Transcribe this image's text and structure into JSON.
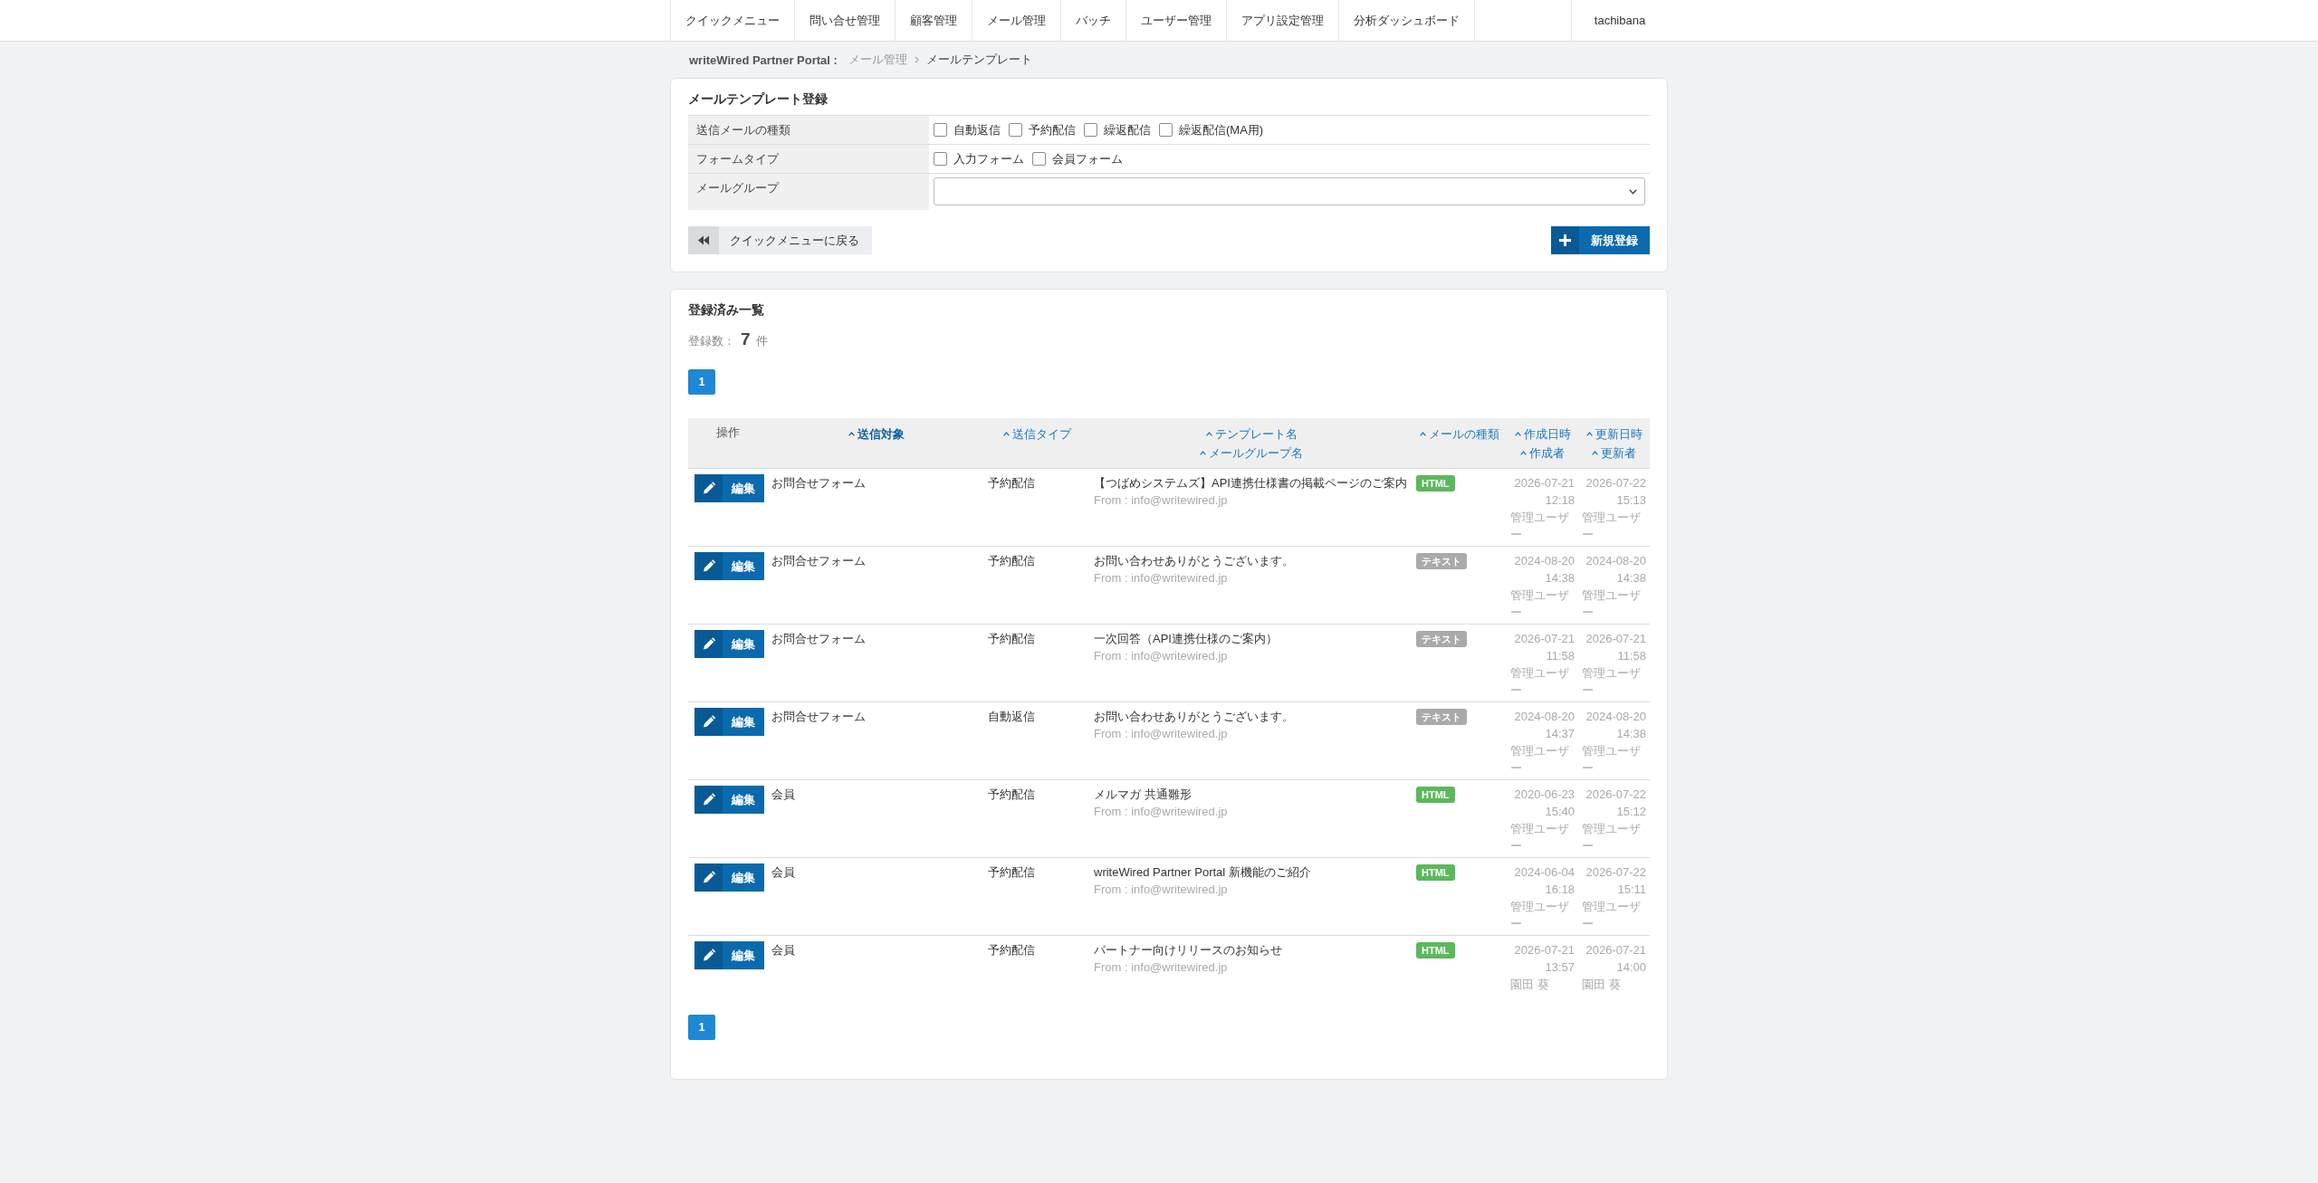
{
  "nav": {
    "items": [
      "クイックメニュー",
      "問い合せ管理",
      "顧客管理",
      "メール管理",
      "バッチ",
      "ユーザー管理",
      "アプリ設定管理",
      "分析ダッシュボード"
    ],
    "user": "tachibana"
  },
  "breadcrumb": {
    "site": "writeWired Partner Portal :",
    "items": [
      {
        "label": "メール管理",
        "current": false
      },
      {
        "label": "メールテンプレート",
        "current": true
      }
    ]
  },
  "register_form": {
    "title": "メールテンプレート登録",
    "fields": [
      {
        "label": "送信メールの種類",
        "kind": "checkboxes",
        "options": [
          {
            "label": "自動返信",
            "checked": false
          },
          {
            "label": "予約配信",
            "checked": false
          },
          {
            "label": "繰返配信",
            "checked": false
          },
          {
            "label": "繰返配信(MA用)",
            "checked": false
          }
        ]
      },
      {
        "label": "フォームタイプ",
        "kind": "checkboxes",
        "options": [
          {
            "label": "入力フォーム",
            "checked": false
          },
          {
            "label": "会員フォーム",
            "checked": false
          }
        ]
      },
      {
        "label": "メールグループ",
        "kind": "select"
      }
    ],
    "back_button": "クイックメニューに戻る",
    "submit_button": "新規登録"
  },
  "registered_list": {
    "title": "登録済み一覧",
    "count_label": "登録数：",
    "count": "7",
    "count_unit": "件",
    "pages": [
      {
        "label": "1",
        "selected": true
      }
    ],
    "columns": [
      {
        "label": "操作"
      },
      {
        "links": [
          {
            "label": "送信対象",
            "sorted": true
          }
        ]
      },
      {
        "links": [
          {
            "label": "送信タイプ",
            "sorted": false
          }
        ]
      },
      {
        "links": [
          {
            "label": "テンプレート名",
            "sorted": false
          },
          {
            "label": "メールグループ名",
            "sorted": false
          }
        ]
      },
      {
        "links": [
          {
            "label": "メールの種類",
            "sorted": false
          }
        ]
      },
      {
        "links": [
          {
            "label": "作成日時",
            "sorted": false
          },
          {
            "label": "作成者",
            "sorted": false
          }
        ]
      },
      {
        "links": [
          {
            "label": "更新日時",
            "sorted": false
          },
          {
            "label": "更新者",
            "sorted": false
          }
        ]
      }
    ],
    "rows": [
      {
        "edit": "編集",
        "target": "お問合せフォーム",
        "send_type": "予約配信",
        "template": "【つばめシステムズ】API連携仕様書の掲載ページのご案内",
        "sender": "From : info@writewired.jp",
        "mail_type": {
          "label": "HTML",
          "color": "#5cb85c"
        },
        "created": "2026-07-21 12:18",
        "created_by": "管理ユーザー",
        "updated": "2026-07-22 15:13",
        "updated_by": "管理ユーザー"
      },
      {
        "edit": "編集",
        "target": "お問合せフォーム",
        "send_type": "予約配信",
        "template": "お問い合わせありがとうございます。",
        "sender": "From : info@writewired.jp",
        "mail_type": {
          "label": "テキスト",
          "color": "#aaaaaa"
        },
        "created": "2024-08-20 14:38",
        "created_by": "管理ユーザー",
        "updated": "2024-08-20 14:38",
        "updated_by": "管理ユーザー"
      },
      {
        "edit": "編集",
        "target": "お問合せフォーム",
        "send_type": "予約配信",
        "template": "一次回答（API連携仕様のご案内）",
        "sender": "From : info@writewired.jp",
        "mail_type": {
          "label": "テキスト",
          "color": "#aaaaaa"
        },
        "created": "2026-07-21 11:58",
        "created_by": "管理ユーザー",
        "updated": "2026-07-21 11:58",
        "updated_by": "管理ユーザー"
      },
      {
        "edit": "編集",
        "target": "お問合せフォーム",
        "send_type": "自動返信",
        "template": "お問い合わせありがとうございます。",
        "sender": "From : info@writewired.jp",
        "mail_type": {
          "label": "テキスト",
          "color": "#aaaaaa"
        },
        "created": "2024-08-20 14:37",
        "created_by": "管理ユーザー",
        "updated": "2024-08-20 14:38",
        "updated_by": "管理ユーザー"
      },
      {
        "edit": "編集",
        "target": "会員",
        "send_type": "予約配信",
        "template": "メルマガ 共通雛形",
        "sender": "From : info@writewired.jp",
        "mail_type": {
          "label": "HTML",
          "color": "#5cb85c"
        },
        "created": "2020-06-23 15:40",
        "created_by": "管理ユーザー",
        "updated": "2026-07-22 15:12",
        "updated_by": "管理ユーザー"
      },
      {
        "edit": "編集",
        "target": "会員",
        "send_type": "予約配信",
        "template": "writeWired Partner Portal 新機能のご紹介",
        "sender": "From : info@writewired.jp",
        "mail_type": {
          "label": "HTML",
          "color": "#5cb85c"
        },
        "created": "2024-06-04 16:18",
        "created_by": "管理ユーザー",
        "updated": "2026-07-22 15:11",
        "updated_by": "管理ユーザー"
      },
      {
        "edit": "編集",
        "target": "会員",
        "send_type": "予約配信",
        "template": "パートナー向けリリースのお知らせ",
        "sender": "From : info@writewired.jp",
        "mail_type": {
          "label": "HTML",
          "color": "#5cb85c"
        },
        "created": "2026-07-21 13:57",
        "created_by": "園田 葵",
        "updated": "2026-07-21 14:00",
        "updated_by": "園田 葵"
      }
    ],
    "pages_bottom": [
      {
        "label": "1",
        "selected": true
      }
    ]
  }
}
